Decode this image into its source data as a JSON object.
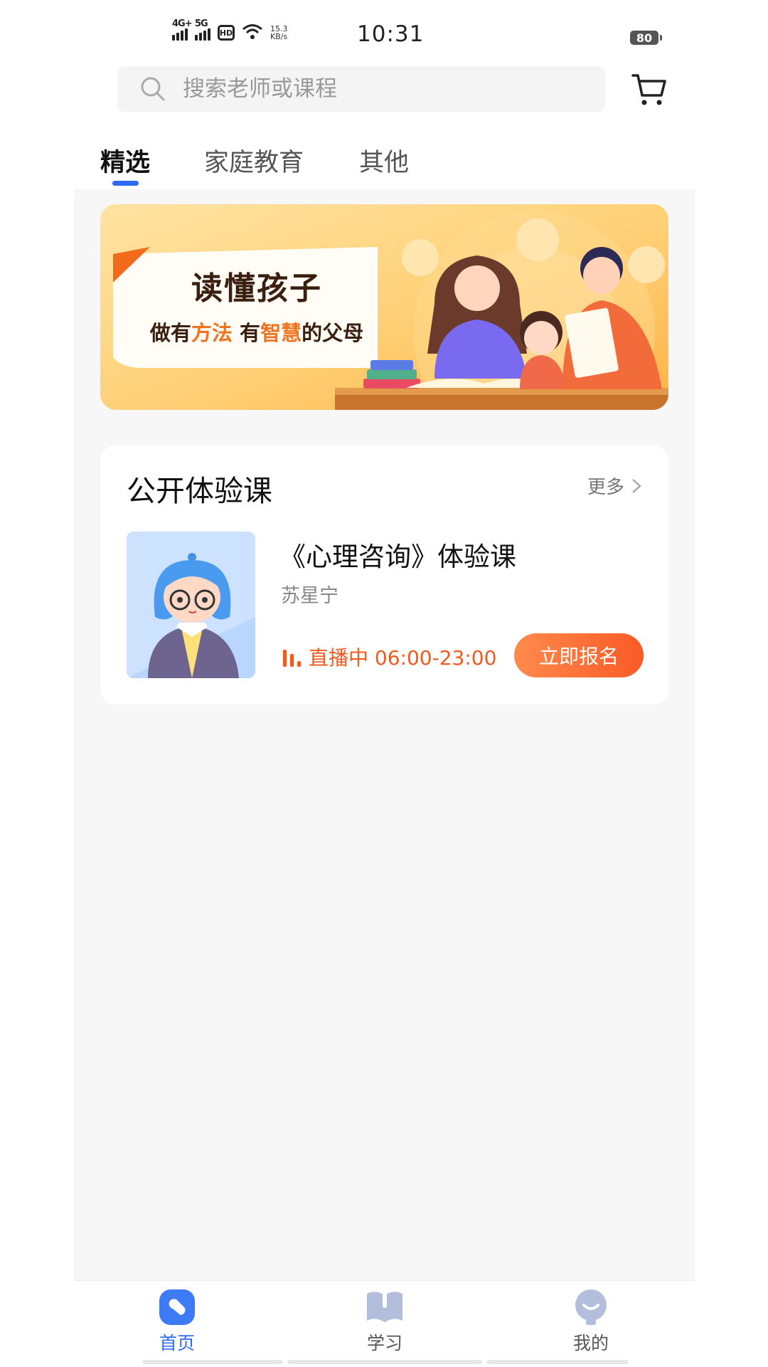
{
  "status_bar": {
    "network1": "4G+",
    "network2": "5G",
    "hd": "HD",
    "speed_value": "15.3",
    "speed_unit": "KB/s",
    "time": "10:31",
    "battery": "80"
  },
  "search": {
    "placeholder": "搜索老师或课程"
  },
  "tabs": [
    {
      "label": "精选",
      "active": true
    },
    {
      "label": "家庭教育",
      "active": false
    },
    {
      "label": "其他",
      "active": false
    }
  ],
  "banner": {
    "headline": "读懂孩子",
    "subline_1": "做有",
    "subline_2": "方法",
    "subline_3": "有",
    "subline_4": "智慧",
    "subline_5": "的父母"
  },
  "section": {
    "title": "公开体验课",
    "more_label": "更多"
  },
  "course": {
    "title": "《心理咨询》体验课",
    "teacher": "苏星宁",
    "live_text": "直播中 06:00-23:00",
    "button_label": "立即报名"
  },
  "bottom_nav": [
    {
      "label": "首页",
      "icon": "home-icon",
      "active": true
    },
    {
      "label": "学习",
      "icon": "book-icon",
      "active": false
    },
    {
      "label": "我的",
      "icon": "profile-icon",
      "active": false
    }
  ],
  "colors": {
    "accent": "#2f6bf0",
    "live": "#f05a1f",
    "button": "#fb5a26"
  }
}
